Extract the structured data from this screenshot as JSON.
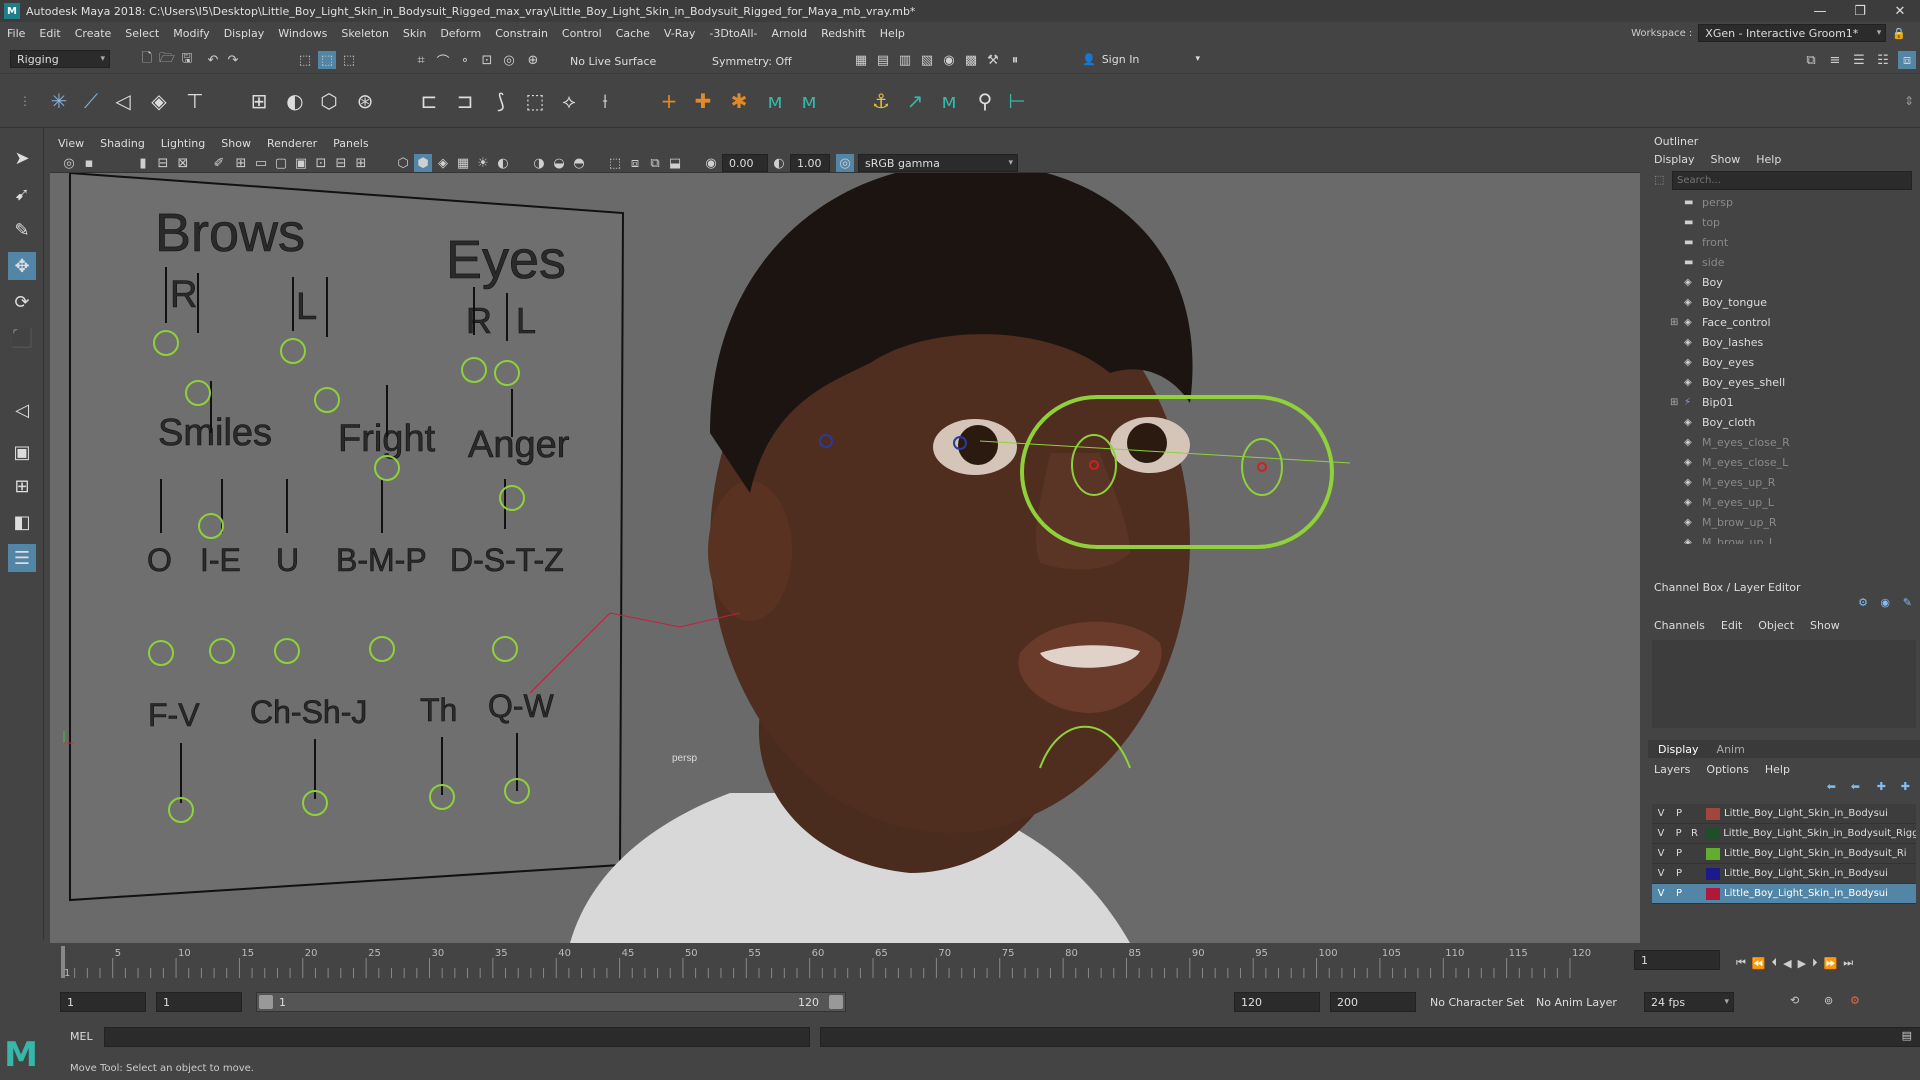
{
  "app": {
    "title": "Autodesk Maya 2018: C:\\Users\\I5\\Desktop\\Little_Boy_Light_Skin_in_Bodysuit_Rigged_max_vray\\Little_Boy_Light_Skin_in_Bodysuit_Rigged_for_Maya_mb_vray.mb*",
    "logo": "M"
  },
  "menubar": [
    "File",
    "Edit",
    "Create",
    "Select",
    "Modify",
    "Display",
    "Windows",
    "Skeleton",
    "Skin",
    "Deform",
    "Constrain",
    "Control",
    "Cache",
    "V-Ray",
    "-3DtoAll-",
    "Arnold",
    "Redshift",
    "Help"
  ],
  "workspace": {
    "label": "Workspace :",
    "value": "XGen - Interactive Groom1*"
  },
  "statusline": {
    "mode": "Rigging",
    "live_surface": "No Live Surface",
    "symmetry": "Symmetry: Off",
    "sign_in": "Sign In"
  },
  "viewport": {
    "menu": [
      "View",
      "Shading",
      "Lighting",
      "Show",
      "Renderer",
      "Panels"
    ],
    "field_a": "0.00",
    "field_b": "1.00",
    "color_space": "sRGB gamma",
    "camera_label": "persp"
  },
  "face_board": {
    "brows": "Brows",
    "eyes": "Eyes",
    "r1": "R",
    "l1": "L",
    "r2": "R",
    "l2": "L",
    "smiles": "Smiles",
    "fright": "Fright",
    "anger": "Anger",
    "o": "O",
    "ie": "I-E",
    "u": "U",
    "bmp": "B-M-P",
    "dstz": "D-S-T-Z",
    "fv": "F-V",
    "chshj": "Ch-Sh-J",
    "th": "Th",
    "qw": "Q-W"
  },
  "outliner": {
    "title": "Outliner",
    "menu": [
      "Display",
      "Show",
      "Help"
    ],
    "search_placeholder": "Search...",
    "items": [
      {
        "name": "persp",
        "type": "camera",
        "dim": true
      },
      {
        "name": "top",
        "type": "camera",
        "dim": true
      },
      {
        "name": "front",
        "type": "camera",
        "dim": true
      },
      {
        "name": "side",
        "type": "camera",
        "dim": true
      },
      {
        "name": "Boy",
        "type": "mesh",
        "dim": false
      },
      {
        "name": "Boy_tongue",
        "type": "mesh",
        "dim": false
      },
      {
        "name": "Face_control",
        "type": "mesh",
        "dim": false,
        "expand": true
      },
      {
        "name": "Boy_lashes",
        "type": "mesh",
        "dim": false
      },
      {
        "name": "Boy_eyes",
        "type": "mesh",
        "dim": false
      },
      {
        "name": "Boy_eyes_shell",
        "type": "mesh",
        "dim": false
      },
      {
        "name": "Bip01",
        "type": "joint",
        "dim": false,
        "expand": true
      },
      {
        "name": "Boy_cloth",
        "type": "mesh",
        "dim": false
      },
      {
        "name": "M_eyes_close_R",
        "type": "mesh",
        "dim": true
      },
      {
        "name": "M_eyes_close_L",
        "type": "mesh",
        "dim": true
      },
      {
        "name": "M_eyes_up_R",
        "type": "mesh",
        "dim": true
      },
      {
        "name": "M_eyes_up_L",
        "type": "mesh",
        "dim": true
      },
      {
        "name": "M_brow_up_R",
        "type": "mesh",
        "dim": true
      },
      {
        "name": "M_brow_up_L",
        "type": "mesh",
        "dim": true
      }
    ]
  },
  "channel_box": {
    "title": "Channel Box / Layer Editor",
    "menu": [
      "Channels",
      "Edit",
      "Object",
      "Show"
    ]
  },
  "layer_editor": {
    "tabs": [
      "Display",
      "Anim"
    ],
    "menu": [
      "Layers",
      "Options",
      "Help"
    ],
    "layers": [
      {
        "v": "V",
        "p": "P",
        "r": "",
        "color": "#a0463a",
        "name": "Little_Boy_Light_Skin_in_Bodysui",
        "selected": false
      },
      {
        "v": "V",
        "p": "P",
        "r": "R",
        "color": "#1e4e2a",
        "name": "Little_Boy_Light_Skin_in_Bodysuit_Rigg",
        "selected": false
      },
      {
        "v": "V",
        "p": "P",
        "r": "",
        "color": "#5fae2e",
        "name": "Little_Boy_Light_Skin_in_Bodysuit_Ri",
        "selected": false
      },
      {
        "v": "V",
        "p": "P",
        "r": "",
        "color": "#1a1a8c",
        "name": "Little_Boy_Light_Skin_in_Bodysui",
        "selected": false
      },
      {
        "v": "V",
        "p": "P",
        "r": "",
        "color": "#b0183a",
        "name": "Little_Boy_Light_Skin_in_Bodysui",
        "selected": true
      }
    ]
  },
  "timeline": {
    "ticks": [
      "1",
      "5",
      "10",
      "15",
      "20",
      "25",
      "30",
      "35",
      "40",
      "45",
      "50",
      "55",
      "60",
      "65",
      "70",
      "75",
      "80",
      "85",
      "90",
      "95",
      "100",
      "105",
      "110",
      "115",
      "120"
    ],
    "current": "1"
  },
  "range": {
    "start": "1",
    "playback_start": "1",
    "slider_start": "1",
    "slider_end": "120",
    "playback_end": "120",
    "end": "200",
    "character_set": "No Character Set",
    "anim_layer": "No Anim Layer",
    "fps": "24 fps"
  },
  "cmdline": {
    "lang": "MEL"
  },
  "helpline": {
    "text": "Move Tool: Select an object to move."
  }
}
